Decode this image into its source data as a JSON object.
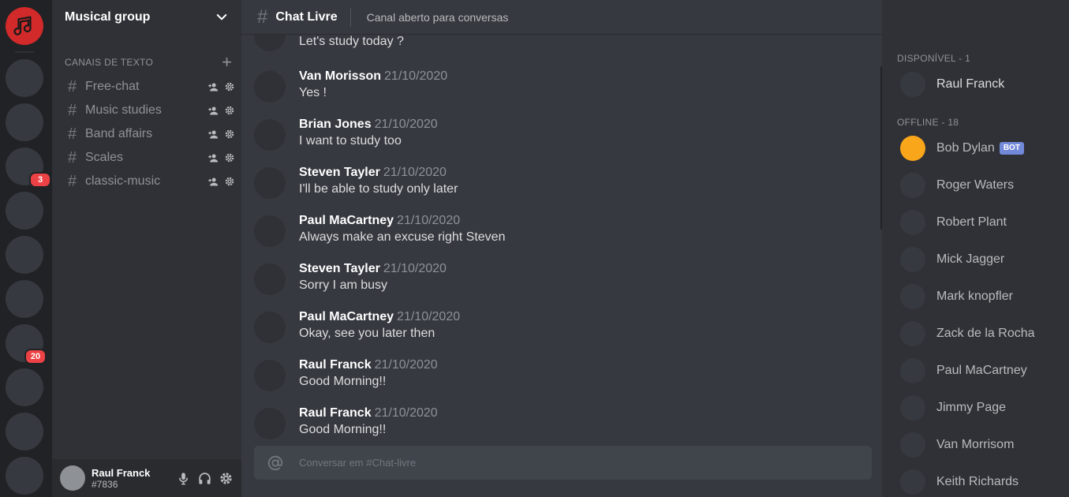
{
  "colors": {
    "rail_bg": "#202225",
    "sidebar_bg": "#2f3136",
    "chat_bg": "#36393f",
    "home_icon_bg": "#d22a2a",
    "badge_bg": "#ed4245",
    "bot_tag_bg": "#7289da",
    "bob_avatar": "#faa61a"
  },
  "rail": {
    "home_icon": "music-note-icon",
    "badges": [
      "3",
      "20"
    ]
  },
  "guild": {
    "name": "Musical group",
    "dropdown_icon": "chevron-down-icon"
  },
  "category": {
    "label": "CANAIS DE TEXTO",
    "add_icon": "plus-icon"
  },
  "channels": [
    {
      "name": "Free-chat"
    },
    {
      "name": "Music studies"
    },
    {
      "name": "Band affairs"
    },
    {
      "name": "Scales"
    },
    {
      "name": "classic-music"
    }
  ],
  "user_panel": {
    "name": "Raul Franck",
    "tag": "#7836",
    "icons": [
      "microphone-icon",
      "headphones-icon",
      "gear-icon"
    ]
  },
  "header": {
    "channel": "Chat Livre",
    "topic": "Canal aberto para conversas"
  },
  "messages": [
    {
      "author": "",
      "time": "",
      "text": "Let's study today ?"
    },
    {
      "author": "Van Morisson",
      "time": "21/10/2020",
      "text": "Yes !"
    },
    {
      "author": "Brian Jones",
      "time": "21/10/2020",
      "text": "I want to study too"
    },
    {
      "author": "Steven Tayler",
      "time": "21/10/2020",
      "text": "I'll be able to study only later"
    },
    {
      "author": "Paul MaCartney",
      "time": "21/10/2020",
      "text": "Always make an excuse right Steven"
    },
    {
      "author": "Steven Tayler",
      "time": "21/10/2020",
      "text": "Sorry I am busy"
    },
    {
      "author": "Paul MaCartney",
      "time": "21/10/2020",
      "text": "Okay, see you later then"
    },
    {
      "author": "Raul Franck",
      "time": "21/10/2020",
      "text": "Good Morning!!"
    },
    {
      "author": "Raul Franck",
      "time": "21/10/2020",
      "text": "Good Morning!!"
    }
  ],
  "composer": {
    "placeholder": "Conversar em #Chat-livre",
    "icon": "at-icon"
  },
  "members": {
    "online_label": "DISPONÍVEL - 1",
    "offline_label": "OFFLINE - 18",
    "online": [
      {
        "name": "Raul Franck"
      }
    ],
    "offline": [
      {
        "name": "Bob Dylan",
        "bot": "BOT"
      },
      {
        "name": "Roger Waters"
      },
      {
        "name": "Robert Plant"
      },
      {
        "name": "Mick Jagger"
      },
      {
        "name": "Mark knopfler"
      },
      {
        "name": "Zack de la Rocha"
      },
      {
        "name": "Paul MaCartney"
      },
      {
        "name": "Jimmy Page"
      },
      {
        "name": "Van Morrisom"
      },
      {
        "name": "Keith Richards"
      }
    ]
  }
}
